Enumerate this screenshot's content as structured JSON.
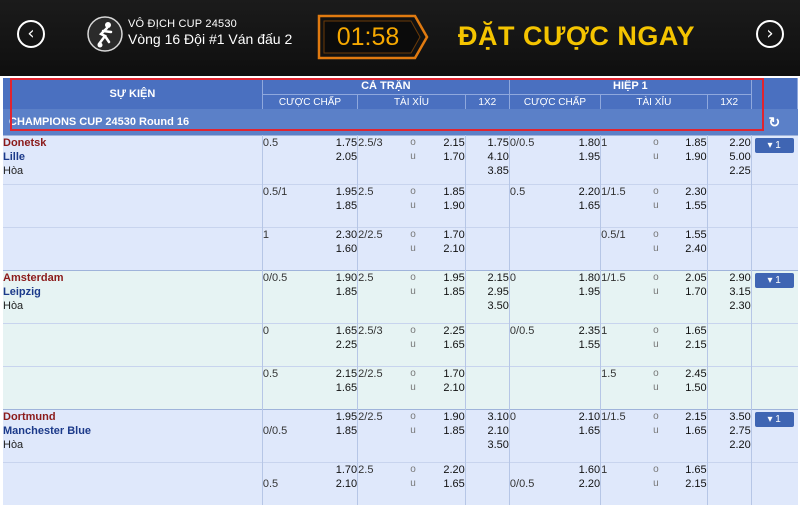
{
  "header": {
    "prev_icon": "chevron-left-icon",
    "next_icon": "chevron-right-icon",
    "prev_glyph": "‹",
    "next_glyph": "›",
    "cup_title": "VÔ ĐỊCH CUP 24530",
    "round_title": "Vòng 16 Đội #1 Ván đấu 2",
    "timer": "01:58",
    "cta": "ĐẶT CƯỢC NGAY",
    "timer_color": "#f6a800",
    "cta_color": "#f4c400"
  },
  "table_header": {
    "event": "SỰ KIỆN",
    "full_time": "CẢ TRẬN",
    "first_half": "HIỆP 1",
    "handicap": "CƯỢC CHẤP",
    "over_under": "TÀI XỈU",
    "one_x_two": "1X2"
  },
  "league": {
    "name": "CHAMPIONS CUP 24530 Round 16",
    "refresh_icon": "refresh-icon",
    "refresh_glyph": "↻"
  },
  "bet_label": "▾ 1",
  "matches": [
    {
      "home": "Donetsk",
      "away": "Lille",
      "draw": "Hòa",
      "rows": [
        {
          "ft_hdp_line": [
            "0.5",
            ""
          ],
          "ft_hdp_odds": [
            "1.75",
            "2.05"
          ],
          "ft_ou_line": [
            "2.5/3",
            ""
          ],
          "ft_ou_lbl": [
            "o",
            "u"
          ],
          "ft_ou_odds": [
            "2.15",
            "1.70"
          ],
          "ft_1x2": [
            "1.75",
            "4.10",
            "3.85"
          ],
          "h1_hdp_line": [
            "0/0.5",
            ""
          ],
          "h1_hdp_odds": [
            "1.80",
            "1.95"
          ],
          "h1_ou_line": [
            "1",
            ""
          ],
          "h1_ou_lbl": [
            "o",
            "u"
          ],
          "h1_ou_odds": [
            "1.85",
            "1.90"
          ],
          "h1_1x2": [
            "2.20",
            "5.00",
            "2.25"
          ]
        },
        {
          "ft_hdp_line": [
            "0.5/1",
            ""
          ],
          "ft_hdp_odds": [
            "1.95",
            "1.85"
          ],
          "ft_ou_line": [
            "2.5",
            ""
          ],
          "ft_ou_lbl": [
            "o",
            "u"
          ],
          "ft_ou_odds": [
            "1.85",
            "1.90"
          ],
          "ft_1x2": [
            "",
            "",
            ""
          ],
          "h1_hdp_line": [
            "0.5",
            ""
          ],
          "h1_hdp_odds": [
            "2.20",
            "1.65"
          ],
          "h1_ou_line": [
            "1/1.5",
            ""
          ],
          "h1_ou_lbl": [
            "o",
            "u"
          ],
          "h1_ou_odds": [
            "2.30",
            "1.55"
          ],
          "h1_1x2": [
            "",
            "",
            ""
          ]
        },
        {
          "ft_hdp_line": [
            "1",
            ""
          ],
          "ft_hdp_odds": [
            "2.30",
            "1.60"
          ],
          "ft_ou_line": [
            "2/2.5",
            ""
          ],
          "ft_ou_lbl": [
            "o",
            "u"
          ],
          "ft_ou_odds": [
            "1.70",
            "2.10"
          ],
          "ft_1x2": [
            "",
            "",
            ""
          ],
          "h1_hdp_line": [
            "",
            ""
          ],
          "h1_hdp_odds": [
            "",
            ""
          ],
          "h1_ou_line": [
            "0.5/1",
            ""
          ],
          "h1_ou_lbl": [
            "o",
            "u"
          ],
          "h1_ou_odds": [
            "1.55",
            "2.40"
          ],
          "h1_1x2": [
            "",
            "",
            ""
          ]
        }
      ]
    },
    {
      "home": "Amsterdam",
      "away": "Leipzig",
      "draw": "Hòa",
      "rows": [
        {
          "ft_hdp_line": [
            "0/0.5",
            ""
          ],
          "ft_hdp_odds": [
            "1.90",
            "1.85"
          ],
          "ft_ou_line": [
            "2.5",
            ""
          ],
          "ft_ou_lbl": [
            "o",
            "u"
          ],
          "ft_ou_odds": [
            "1.95",
            "1.85"
          ],
          "ft_1x2": [
            "2.15",
            "2.95",
            "3.50"
          ],
          "h1_hdp_line": [
            "0",
            ""
          ],
          "h1_hdp_odds": [
            "1.80",
            "1.95"
          ],
          "h1_ou_line": [
            "1/1.5",
            ""
          ],
          "h1_ou_lbl": [
            "o",
            "u"
          ],
          "h1_ou_odds": [
            "2.05",
            "1.70"
          ],
          "h1_1x2": [
            "2.90",
            "3.15",
            "2.30"
          ]
        },
        {
          "ft_hdp_line": [
            "0",
            ""
          ],
          "ft_hdp_odds": [
            "1.65",
            "2.25"
          ],
          "ft_ou_line": [
            "2.5/3",
            ""
          ],
          "ft_ou_lbl": [
            "o",
            "u"
          ],
          "ft_ou_odds": [
            "2.25",
            "1.65"
          ],
          "ft_1x2": [
            "",
            "",
            ""
          ],
          "h1_hdp_line": [
            "0/0.5",
            ""
          ],
          "h1_hdp_odds": [
            "2.35",
            "1.55"
          ],
          "h1_ou_line": [
            "1",
            ""
          ],
          "h1_ou_lbl": [
            "o",
            "u"
          ],
          "h1_ou_odds": [
            "1.65",
            "2.15"
          ],
          "h1_1x2": [
            "",
            "",
            ""
          ]
        },
        {
          "ft_hdp_line": [
            "0.5",
            ""
          ],
          "ft_hdp_odds": [
            "2.15",
            "1.65"
          ],
          "ft_ou_line": [
            "2/2.5",
            ""
          ],
          "ft_ou_lbl": [
            "o",
            "u"
          ],
          "ft_ou_odds": [
            "1.70",
            "2.10"
          ],
          "ft_1x2": [
            "",
            "",
            ""
          ],
          "h1_hdp_line": [
            "",
            ""
          ],
          "h1_hdp_odds": [
            "",
            ""
          ],
          "h1_ou_line": [
            "1.5",
            ""
          ],
          "h1_ou_lbl": [
            "o",
            "u"
          ],
          "h1_ou_odds": [
            "2.45",
            "1.50"
          ],
          "h1_1x2": [
            "",
            "",
            ""
          ]
        }
      ]
    },
    {
      "home": "Dortmund",
      "away": "Manchester Blue",
      "draw": "Hòa",
      "rows": [
        {
          "ft_hdp_line": [
            "",
            "0/0.5"
          ],
          "ft_hdp_odds": [
            "1.95",
            "1.85"
          ],
          "ft_ou_line": [
            "2/2.5",
            ""
          ],
          "ft_ou_lbl": [
            "o",
            "u"
          ],
          "ft_ou_odds": [
            "1.90",
            "1.85"
          ],
          "ft_1x2": [
            "3.10",
            "2.10",
            "3.50"
          ],
          "h1_hdp_line": [
            "0",
            ""
          ],
          "h1_hdp_odds": [
            "2.10",
            "1.65"
          ],
          "h1_ou_line": [
            "1/1.5",
            ""
          ],
          "h1_ou_lbl": [
            "o",
            "u"
          ],
          "h1_ou_odds": [
            "2.15",
            "1.65"
          ],
          "h1_1x2": [
            "3.50",
            "2.75",
            "2.20"
          ]
        },
        {
          "ft_hdp_line": [
            "",
            "0.5"
          ],
          "ft_hdp_odds": [
            "1.70",
            "2.10"
          ],
          "ft_ou_line": [
            "2.5",
            ""
          ],
          "ft_ou_lbl": [
            "o",
            "u"
          ],
          "ft_ou_odds": [
            "2.20",
            "1.65"
          ],
          "ft_1x2": [
            "",
            "",
            ""
          ],
          "h1_hdp_line": [
            "",
            "0/0.5"
          ],
          "h1_hdp_odds": [
            "1.60",
            "2.20"
          ],
          "h1_ou_line": [
            "1",
            ""
          ],
          "h1_ou_lbl": [
            "o",
            "u"
          ],
          "h1_ou_odds": [
            "1.65",
            "2.15"
          ],
          "h1_1x2": [
            "",
            "",
            ""
          ]
        }
      ]
    }
  ]
}
